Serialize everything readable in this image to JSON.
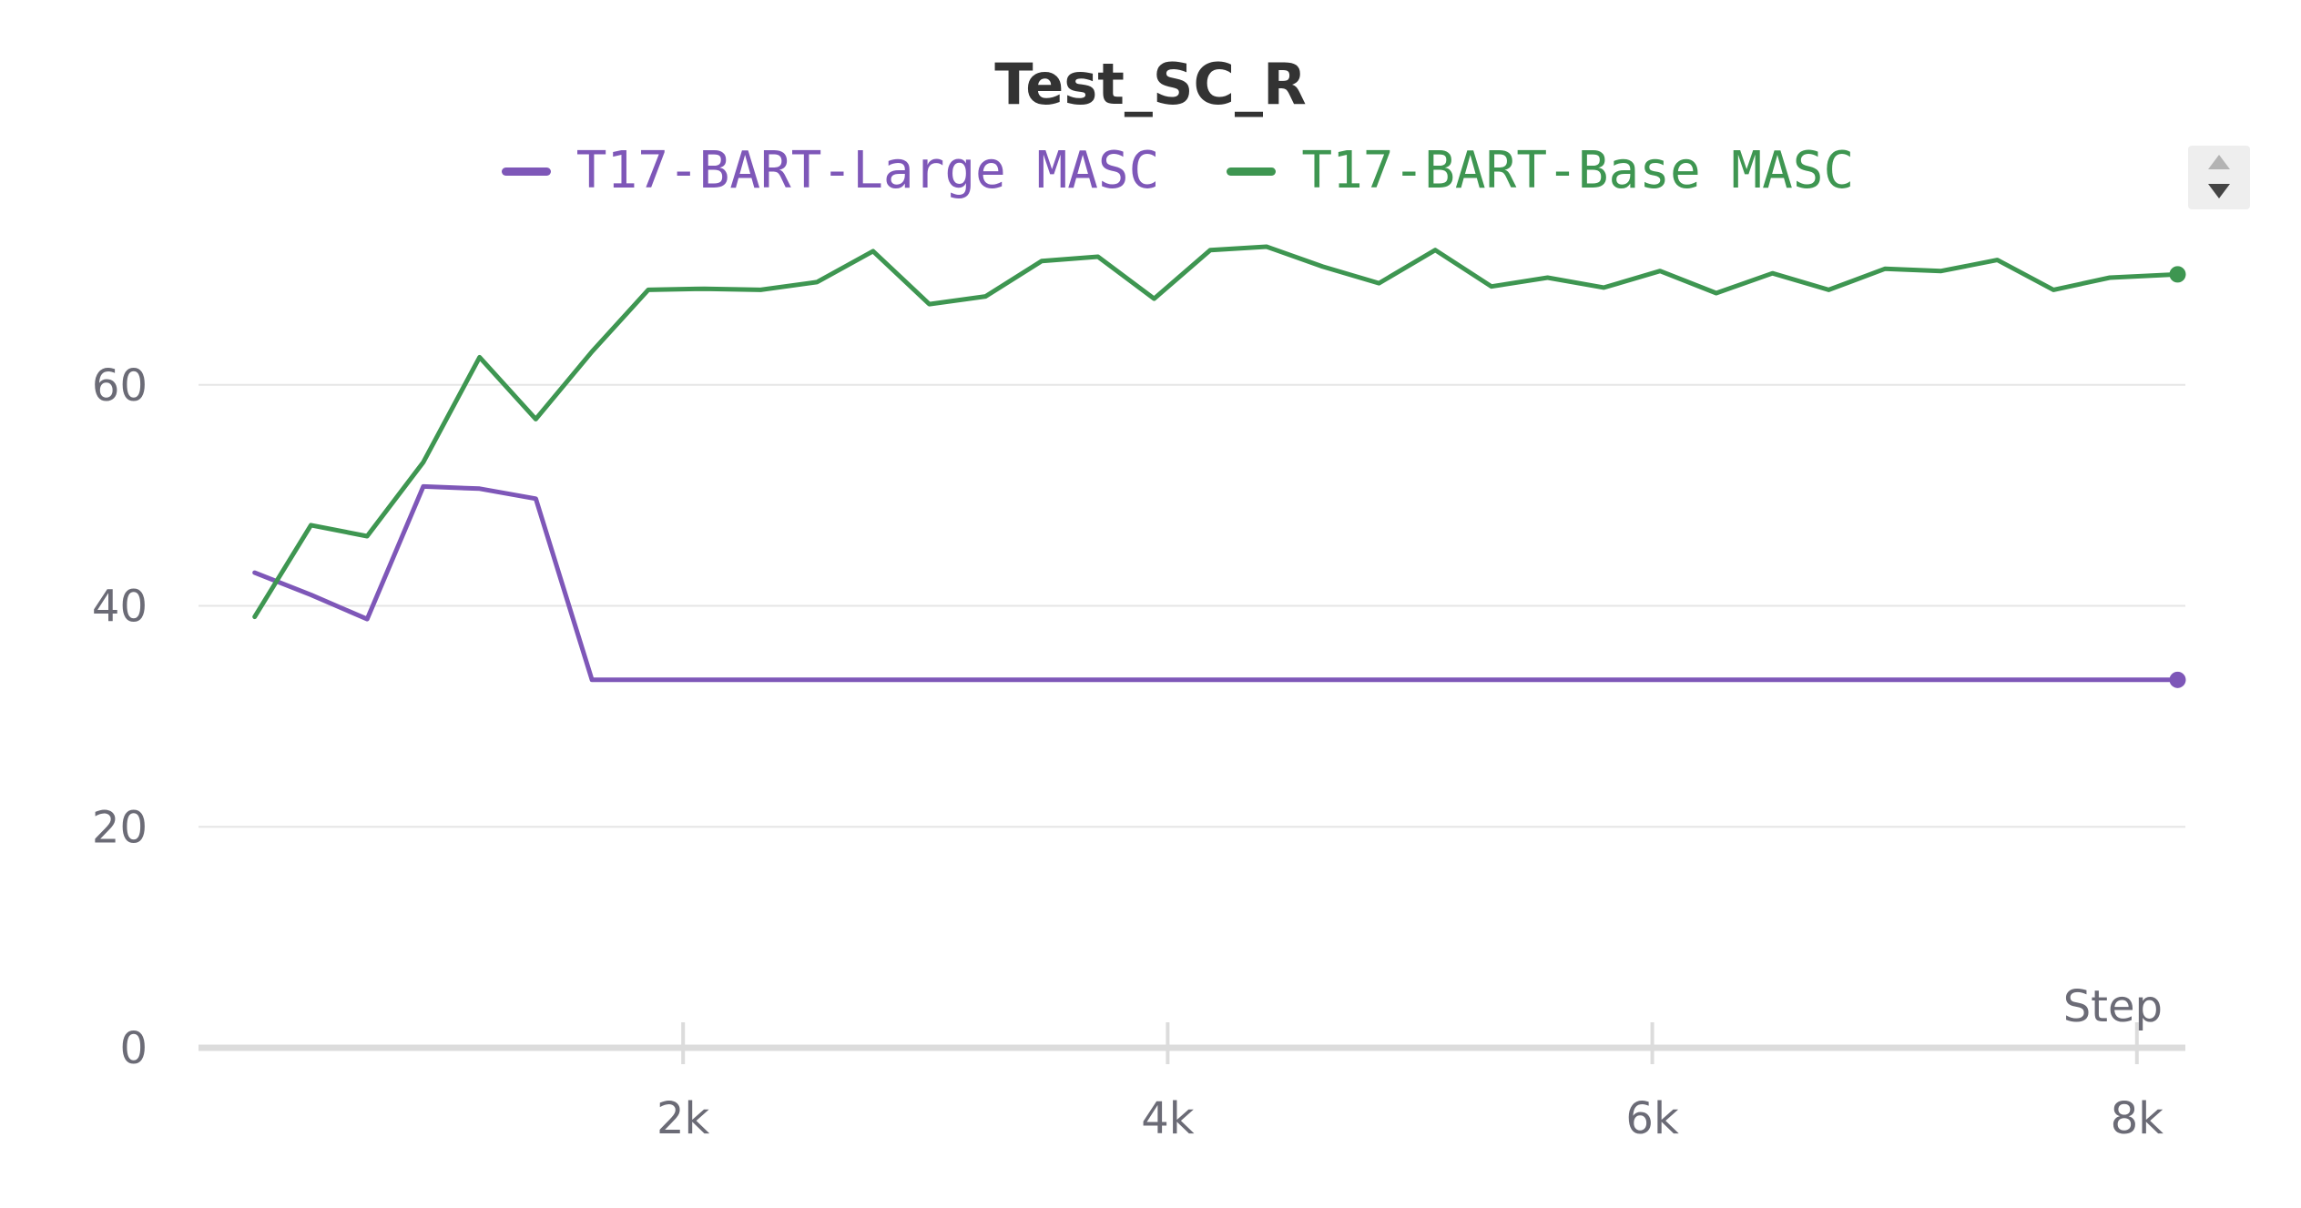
{
  "chart_data": {
    "type": "line",
    "title": "Test_SC_R",
    "xlabel": "Step",
    "ylabel": "",
    "xlim": [
      0,
      8200
    ],
    "ylim": [
      0,
      80
    ],
    "x_ticks": [
      2000,
      4000,
      6000,
      8000
    ],
    "x_tick_labels": [
      "2k",
      "4k",
      "6k",
      "8k"
    ],
    "y_ticks": [
      0,
      20,
      40,
      60
    ],
    "y_tick_labels": [
      "0",
      "20",
      "40",
      "60"
    ],
    "grid": "horizontal",
    "legend_position": "top",
    "series": [
      {
        "name": "T17-BART-Large MASC",
        "color": "#7e57b8",
        "x": [
          232,
          464,
          696,
          928,
          1160,
          1392,
          1624,
          8168
        ],
        "y": [
          43,
          41,
          38.8,
          50.8,
          50.6,
          49.7,
          33.3,
          33.3
        ]
      },
      {
        "name": "T17-BART-Base MASC",
        "color": "#3e9651",
        "x": [
          232,
          464,
          696,
          928,
          1160,
          1392,
          1624,
          1856,
          2088,
          2320,
          2552,
          2784,
          3016,
          3248,
          3480,
          3712,
          3944,
          4176,
          4408,
          4640,
          4872,
          5104,
          5336,
          5568,
          5800,
          6032,
          6264,
          6496,
          6728,
          6960,
          7192,
          7424,
          7656,
          7888,
          8168
        ],
        "y": [
          39,
          47.3,
          46.3,
          53,
          62.5,
          56.9,
          63,
          68.6,
          68.7,
          68.6,
          69.3,
          72.1,
          67.3,
          68,
          71.2,
          71.6,
          67.8,
          72.2,
          72.5,
          70.7,
          69.2,
          72.2,
          68.9,
          69.7,
          68.8,
          70.3,
          68.3,
          70.1,
          68.6,
          70.5,
          70.3,
          71.3,
          68.6,
          69.7,
          70
        ]
      }
    ]
  }
}
